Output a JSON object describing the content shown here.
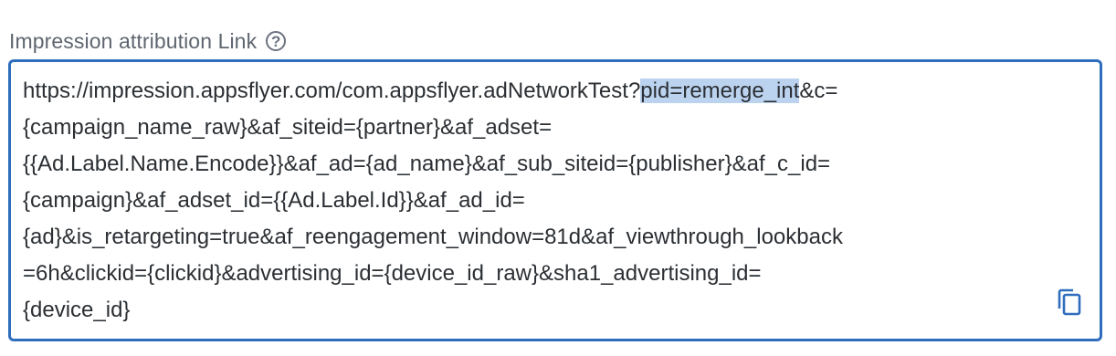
{
  "field": {
    "label": "Impression attribution Link",
    "help_icon": "question-circle-icon",
    "copy_icon": "copy-icon",
    "accent_color": "#2f6dbd",
    "selection_color": "#bcd3f0"
  },
  "link": {
    "line1_before": "https://impression.appsflyer.com/com.appsflyer.adNetworkTest?",
    "line1_selected": "pid=remerge_int",
    "line1_after": "&c=",
    "line2": "{campaign_name_raw}&af_siteid={partner}&af_adset=",
    "line3": "{{Ad.Label.Name.Encode}}&af_ad={ad_name}&af_sub_siteid={publisher}&af_c_id=",
    "line4": "{campaign}&af_adset_id={{Ad.Label.Id}}&af_ad_id=",
    "line5": "{ad}&is_retargeting=true&af_reengagement_window=81d&af_viewthrough_lookback",
    "line6": "=6h&clickid={clickid}&advertising_id={device_id_raw}&sha1_advertising_id=",
    "line7": "{device_id}"
  }
}
